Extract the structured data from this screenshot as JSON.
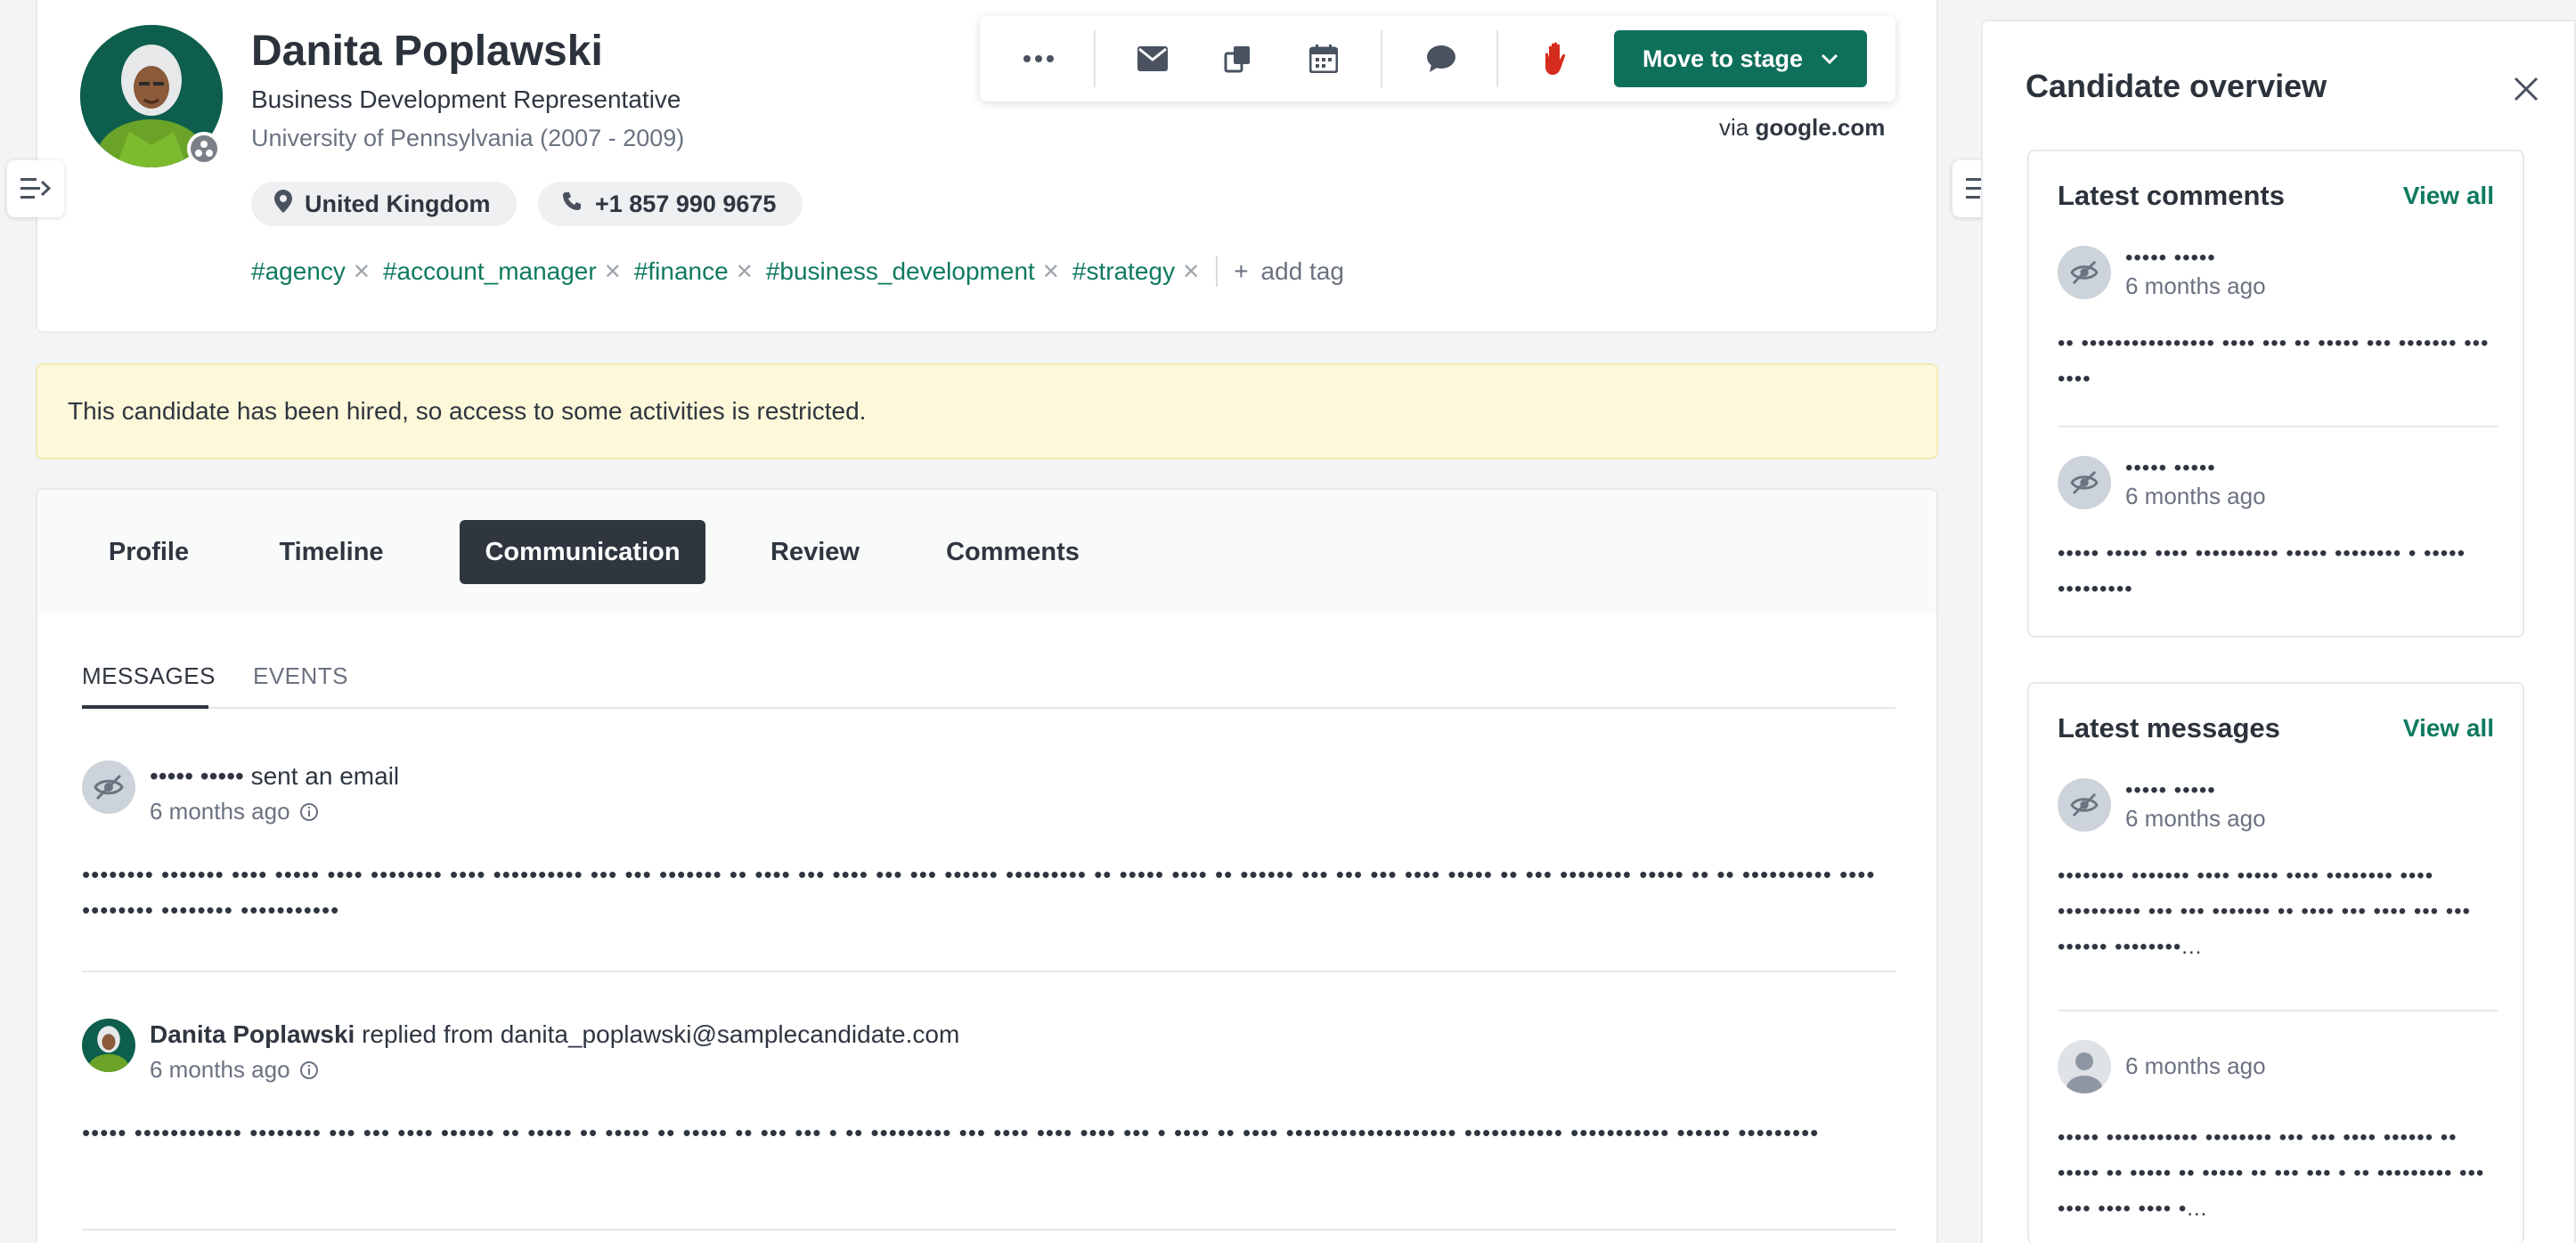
{
  "candidate": {
    "name": "Danita Poplawski",
    "title": "Business Development Representative",
    "education": "University of Pennsylvania (2007 - 2009)",
    "location": "United Kingdom",
    "phone": "+1 857 990 9675",
    "source_prefix": "via",
    "source": "google.com"
  },
  "tags": [
    "#agency",
    "#account_manager",
    "#finance",
    "#business_development",
    "#strategy"
  ],
  "add_tag_label": "add tag",
  "toolbar": {
    "move_to_stage_label": "Move to stage",
    "icons": [
      "more-icon",
      "email-icon",
      "copy-icon",
      "calendar-icon",
      "chat-icon",
      "stop-hand-icon"
    ]
  },
  "notice": "This candidate has been hired, so access to some activities is restricted.",
  "tabs": [
    "Profile",
    "Timeline",
    "Communication",
    "Review",
    "Comments"
  ],
  "active_tab": "Communication",
  "subtabs": [
    "MESSAGES",
    "EVENTS"
  ],
  "messages": [
    {
      "author": "••••• •••••",
      "action": "sent an email",
      "time": "6 months ago",
      "body": "•••••••• ••••••• •••• ••••• •••• •••••••• •••• •••••••••• ••• ••• ••••••• •• •••• ••• •••• ••• ••• •••••• ••••••••• •• ••••• •••• •• •••••• ••• ••• ••• •••• ••••• •• ••• •••••••• ••••• •• •• •••••••••• •••• •••••••• •••••••• •••••••••••"
    },
    {
      "author": "Danita Poplawski",
      "action": "replied from danita_poplawski@samplecandidate.com",
      "time": "6 months ago",
      "body": "••••• •••••••••••• •••••••• ••• ••• •••• •••••• •• ••••• •• ••••• •• ••••• •• ••• ••• • •• ••••••••• ••• •••• •••• •••• ••• • •••• •• •••• ••••••••••••••••••• ••••••••••• ••••••••••• •••••• •••••••••"
    }
  ],
  "overview": {
    "title": "Candidate overview",
    "comments_title": "Latest comments",
    "messages_title": "Latest messages",
    "view_all": "View all",
    "comments": [
      {
        "author": "••••• •••••",
        "time": "6 months ago",
        "text": "•• •••••••••••••••• •••• ••• •• ••••• ••• ••••••• ••• ••••"
      },
      {
        "author": "••••• •••••",
        "time": "6 months ago",
        "text": "••••• ••••• •••• •••••••••• ••••• •••••••• • ••••• •••••••••"
      }
    ],
    "messages": [
      {
        "author": "••••• •••••",
        "time": "6 months ago",
        "text": "•••••••• ••••••• •••• ••••• •••• •••••••• •••• •••••••••• ••• ••• ••••••• •• •••• ••• •••• ••• ••• •••••• ••••••••..."
      },
      {
        "author": "",
        "time": "6 months ago",
        "text": "••••• ••••••••••• •••••••• ••• ••• •••• •••••• •• ••••• •• ••••• •• ••••• •• ••• ••• • •• ••••••••• ••• •••• •••• •••• •..."
      }
    ]
  },
  "colors": {
    "brand_green": "#0e6f5b",
    "tag_green": "#0f7a5f",
    "notice_bg": "#fdf8d9",
    "stop_red": "#d62b1f",
    "active_tab_bg": "#2f3640"
  }
}
